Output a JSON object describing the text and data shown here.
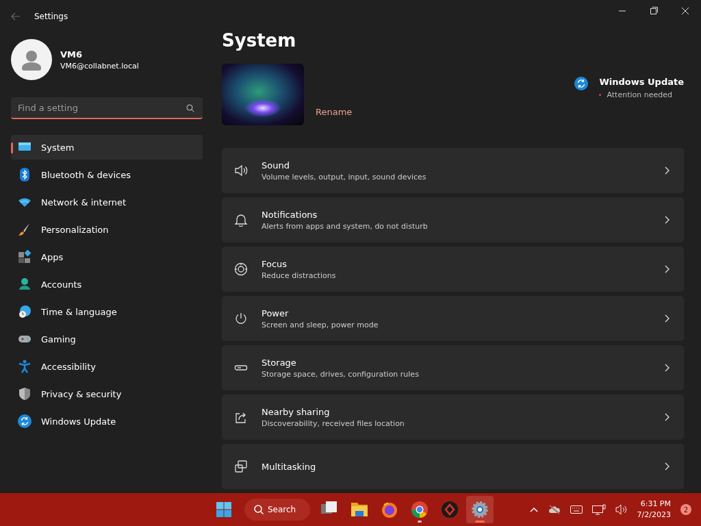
{
  "window": {
    "title": "Settings"
  },
  "account": {
    "name": "VM6",
    "email": "VM6@collabnet.local"
  },
  "search": {
    "placeholder": "Find a setting"
  },
  "sidebar": {
    "items": [
      {
        "label": "System",
        "kind": "system",
        "selected": true
      },
      {
        "label": "Bluetooth & devices",
        "kind": "bluetooth",
        "selected": false
      },
      {
        "label": "Network & internet",
        "kind": "wifi",
        "selected": false
      },
      {
        "label": "Personalization",
        "kind": "brush",
        "selected": false
      },
      {
        "label": "Apps",
        "kind": "apps",
        "selected": false
      },
      {
        "label": "Accounts",
        "kind": "person",
        "selected": false
      },
      {
        "label": "Time & language",
        "kind": "globe",
        "selected": false
      },
      {
        "label": "Gaming",
        "kind": "gamepad",
        "selected": false
      },
      {
        "label": "Accessibility",
        "kind": "accessibility",
        "selected": false
      },
      {
        "label": "Privacy & security",
        "kind": "shield",
        "selected": false
      },
      {
        "label": "Windows Update",
        "kind": "update",
        "selected": false
      }
    ]
  },
  "page": {
    "title": "System",
    "rename": "Rename",
    "update": {
      "title": "Windows Update",
      "status": "Attention needed",
      "alert": true
    },
    "cards": [
      {
        "kind": "speaker",
        "title": "Sound",
        "subtitle": "Volume levels, output, input, sound devices"
      },
      {
        "kind": "bell",
        "title": "Notifications",
        "subtitle": "Alerts from apps and system, do not disturb"
      },
      {
        "kind": "focus",
        "title": "Focus",
        "subtitle": "Reduce distractions"
      },
      {
        "kind": "power",
        "title": "Power",
        "subtitle": "Screen and sleep, power mode"
      },
      {
        "kind": "storage",
        "title": "Storage",
        "subtitle": "Storage space, drives, configuration rules"
      },
      {
        "kind": "share",
        "title": "Nearby sharing",
        "subtitle": "Discoverability, received files location"
      },
      {
        "kind": "windows",
        "title": "Multitasking"
      }
    ]
  },
  "taskbar": {
    "search": "Search",
    "apps": [
      {
        "kind": "taskview",
        "running": false,
        "active": false
      },
      {
        "kind": "folder",
        "running": false,
        "active": false
      },
      {
        "kind": "firefox",
        "running": false,
        "active": false
      },
      {
        "kind": "chrome",
        "running": true,
        "active": false
      },
      {
        "kind": "redapp",
        "running": false,
        "active": false
      },
      {
        "kind": "gear",
        "running": true,
        "active": true
      }
    ],
    "time": "6:31 PM",
    "date": "7/2/2023",
    "badge": "2"
  }
}
